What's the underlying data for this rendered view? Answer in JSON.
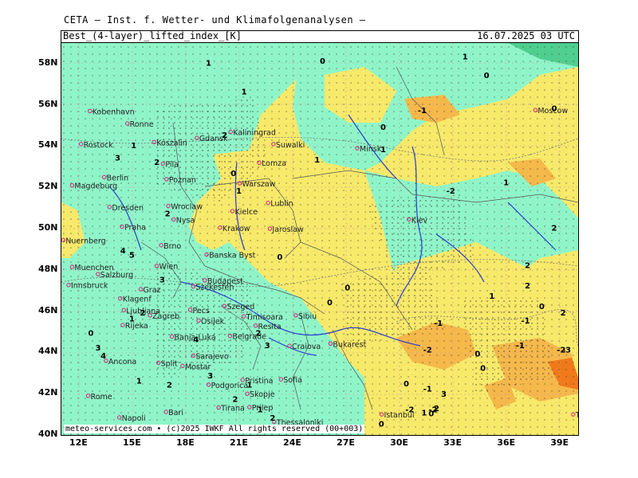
{
  "header": {
    "institution": "CETA — Inst. f. Wetter- und Klimafolgenanalysen —",
    "product": "Best_(4-layer)_lifted_index_[K]",
    "valid_time": "16.07.2025 03 UTC"
  },
  "footer": "meteo-services.com • (c)2025 IWKF All rights reserved (00+003)",
  "colors": {
    "yellow": "#f7e96a",
    "green": "#8ff5c8",
    "teal": "#4ecf8f",
    "orange": "#f5b84a",
    "deep_orange": "#f07a1a",
    "rivers": "#2a3bd0",
    "borders": "#555555",
    "cities": "#d0207a"
  },
  "axes": {
    "lat": [
      "58N",
      "56N",
      "54N",
      "52N",
      "50N",
      "48N",
      "46N",
      "44N",
      "42N",
      "40N"
    ],
    "lon": [
      "12E",
      "15E",
      "18E",
      "21E",
      "24E",
      "27E",
      "30E",
      "33E",
      "36E",
      "39E"
    ]
  },
  "cities": [
    {
      "name": "Kobenhavn",
      "lon": 12.6,
      "lat": 55.7
    },
    {
      "name": "Ronne",
      "lon": 14.7,
      "lat": 55.1
    },
    {
      "name": "Rostock",
      "lon": 12.1,
      "lat": 54.1
    },
    {
      "name": "Koszalin",
      "lon": 16.2,
      "lat": 54.2
    },
    {
      "name": "Gdansk",
      "lon": 18.6,
      "lat": 54.4
    },
    {
      "name": "Kaliningrad",
      "lon": 20.5,
      "lat": 54.7
    },
    {
      "name": "Suwalki",
      "lon": 22.9,
      "lat": 54.1
    },
    {
      "name": "Minsk",
      "lon": 27.6,
      "lat": 53.9
    },
    {
      "name": "Moscow",
      "lon": 37.6,
      "lat": 55.75
    },
    {
      "name": "Pila",
      "lon": 16.7,
      "lat": 53.15
    },
    {
      "name": "Lomza",
      "lon": 22.1,
      "lat": 53.2
    },
    {
      "name": "Berlin",
      "lon": 13.4,
      "lat": 52.5
    },
    {
      "name": "Magdeburg",
      "lon": 11.6,
      "lat": 52.1
    },
    {
      "name": "Poznan",
      "lon": 16.9,
      "lat": 52.4
    },
    {
      "name": "Warszaw",
      "lon": 21.0,
      "lat": 52.2
    },
    {
      "name": "Lublin",
      "lon": 22.6,
      "lat": 51.25
    },
    {
      "name": "Dresden",
      "lon": 13.7,
      "lat": 51.05
    },
    {
      "name": "Wroclaw",
      "lon": 17.0,
      "lat": 51.1
    },
    {
      "name": "Kielce",
      "lon": 20.6,
      "lat": 50.85
    },
    {
      "name": "Nysa",
      "lon": 17.3,
      "lat": 50.45
    },
    {
      "name": "Kiev",
      "lon": 30.5,
      "lat": 50.45
    },
    {
      "name": "Praha",
      "lon": 14.4,
      "lat": 50.1
    },
    {
      "name": "Krakow",
      "lon": 19.9,
      "lat": 50.05
    },
    {
      "name": "Jaroslaw",
      "lon": 22.7,
      "lat": 50.0
    },
    {
      "name": "Nuernberg",
      "lon": 11.1,
      "lat": 49.45
    },
    {
      "name": "Brno",
      "lon": 16.6,
      "lat": 49.2
    },
    {
      "name": "Banska Byst",
      "lon": 19.15,
      "lat": 48.75
    },
    {
      "name": "Muenchen",
      "lon": 11.6,
      "lat": 48.15
    },
    {
      "name": "Wien",
      "lon": 16.35,
      "lat": 48.2
    },
    {
      "name": "Salzburg",
      "lon": 13.05,
      "lat": 47.8
    },
    {
      "name": "Innsbruck",
      "lon": 11.4,
      "lat": 47.27
    },
    {
      "name": "Budapest",
      "lon": 19.05,
      "lat": 47.5
    },
    {
      "name": "Szekesfeh",
      "lon": 18.4,
      "lat": 47.2
    },
    {
      "name": "Graz",
      "lon": 15.45,
      "lat": 47.07
    },
    {
      "name": "Klagenf",
      "lon": 14.3,
      "lat": 46.62
    },
    {
      "name": "Szeged",
      "lon": 20.15,
      "lat": 46.25
    },
    {
      "name": "Ljubljana",
      "lon": 14.5,
      "lat": 46.05
    },
    {
      "name": "Pecs",
      "lon": 18.23,
      "lat": 46.07
    },
    {
      "name": "Zagreb",
      "lon": 15.97,
      "lat": 45.8
    },
    {
      "name": "Rijeka",
      "lon": 14.44,
      "lat": 45.33
    },
    {
      "name": "Osijek",
      "lon": 18.7,
      "lat": 45.55
    },
    {
      "name": "Timisoara",
      "lon": 21.23,
      "lat": 45.75
    },
    {
      "name": "Sibiu",
      "lon": 24.15,
      "lat": 45.8
    },
    {
      "name": "Resita",
      "lon": 21.9,
      "lat": 45.3
    },
    {
      "name": "Banja Luka",
      "lon": 17.2,
      "lat": 44.77
    },
    {
      "name": "Belgrade",
      "lon": 20.46,
      "lat": 44.8
    },
    {
      "name": "Bukarest",
      "lon": 26.1,
      "lat": 44.43
    },
    {
      "name": "Craiova",
      "lon": 23.8,
      "lat": 44.32
    },
    {
      "name": "Ancona",
      "lon": 13.5,
      "lat": 43.6
    },
    {
      "name": "Split",
      "lon": 16.44,
      "lat": 43.5
    },
    {
      "name": "Sarajevo",
      "lon": 18.4,
      "lat": 43.85
    },
    {
      "name": "Mostar",
      "lon": 17.8,
      "lat": 43.35
    },
    {
      "name": "Pristina",
      "lon": 21.17,
      "lat": 42.67
    },
    {
      "name": "Sofia",
      "lon": 23.32,
      "lat": 42.7
    },
    {
      "name": "Podgorica",
      "lon": 19.26,
      "lat": 42.44
    },
    {
      "name": "Skopje",
      "lon": 21.43,
      "lat": 42.0
    },
    {
      "name": "Rome",
      "lon": 12.5,
      "lat": 41.9
    },
    {
      "name": "Tirana",
      "lon": 19.82,
      "lat": 41.33
    },
    {
      "name": "Prilep",
      "lon": 21.55,
      "lat": 41.35
    },
    {
      "name": "Napoli",
      "lon": 14.25,
      "lat": 40.85
    },
    {
      "name": "Bari",
      "lon": 16.87,
      "lat": 41.12
    },
    {
      "name": "Thessaloniki",
      "lon": 22.94,
      "lat": 40.64
    },
    {
      "name": "Istanbul",
      "lon": 28.97,
      "lat": 41.0
    },
    {
      "name": "Trabzon",
      "lon": 39.72,
      "lat": 41.0
    }
  ],
  "values": [
    {
      "v": "1",
      "lon": 19.1,
      "lat": 57.9
    },
    {
      "v": "0",
      "lon": 25.5,
      "lat": 58.0
    },
    {
      "v": "1",
      "lon": 33.5,
      "lat": 58.2
    },
    {
      "v": "0",
      "lon": 34.7,
      "lat": 57.3
    },
    {
      "v": "1",
      "lon": 21.1,
      "lat": 56.5
    },
    {
      "v": "0",
      "lon": 38.5,
      "lat": 55.7
    },
    {
      "v": "-1",
      "lon": 31.0,
      "lat": 55.6
    },
    {
      "v": "0",
      "lon": 28.9,
      "lat": 54.8
    },
    {
      "v": "1",
      "lon": 14.9,
      "lat": 53.9
    },
    {
      "v": "2",
      "lon": 20.0,
      "lat": 54.4
    },
    {
      "v": "1",
      "lon": 28.9,
      "lat": 53.7
    },
    {
      "v": "1",
      "lon": 25.2,
      "lat": 53.2
    },
    {
      "v": "3",
      "lon": 14.0,
      "lat": 53.3
    },
    {
      "v": "2",
      "lon": 16.2,
      "lat": 53.1
    },
    {
      "v": "0",
      "lon": 20.5,
      "lat": 52.55
    },
    {
      "v": "1",
      "lon": 35.8,
      "lat": 52.1
    },
    {
      "v": "1",
      "lon": 20.8,
      "lat": 51.7
    },
    {
      "v": "-2",
      "lon": 32.6,
      "lat": 51.7
    },
    {
      "v": "2",
      "lon": 16.8,
      "lat": 50.6
    },
    {
      "v": "2",
      "lon": 38.5,
      "lat": 49.9
    },
    {
      "v": "4",
      "lon": 14.3,
      "lat": 48.8
    },
    {
      "v": "5",
      "lon": 14.8,
      "lat": 48.6
    },
    {
      "v": "0",
      "lon": 23.1,
      "lat": 48.5
    },
    {
      "v": "2",
      "lon": 37.0,
      "lat": 48.1
    },
    {
      "v": "3",
      "lon": 16.5,
      "lat": 47.4
    },
    {
      "v": "2",
      "lon": 37.0,
      "lat": 47.1
    },
    {
      "v": "0",
      "lon": 26.9,
      "lat": 47.0
    },
    {
      "v": "1",
      "lon": 35.0,
      "lat": 46.6
    },
    {
      "v": "0",
      "lon": 25.9,
      "lat": 46.3
    },
    {
      "v": "0",
      "lon": 37.8,
      "lat": 46.1
    },
    {
      "v": "-1",
      "lon": 36.8,
      "lat": 45.4
    },
    {
      "v": "2",
      "lon": 39.0,
      "lat": 45.8
    },
    {
      "v": "-1",
      "lon": 31.9,
      "lat": 45.3
    },
    {
      "v": "2",
      "lon": 15.4,
      "lat": 45.8
    },
    {
      "v": "1",
      "lon": 14.8,
      "lat": 45.5
    },
    {
      "v": "0",
      "lon": 12.5,
      "lat": 44.8
    },
    {
      "v": "4",
      "lon": 18.4,
      "lat": 44.5
    },
    {
      "v": "2",
      "lon": 21.9,
      "lat": 44.8
    },
    {
      "v": "3",
      "lon": 22.4,
      "lat": 44.2
    },
    {
      "v": "-1",
      "lon": 36.5,
      "lat": 44.2
    },
    {
      "v": "-2",
      "lon": 31.3,
      "lat": 44.0
    },
    {
      "v": "3",
      "lon": 12.9,
      "lat": 44.1
    },
    {
      "v": "-2",
      "lon": 38.8,
      "lat": 44.0
    },
    {
      "v": "-3",
      "lon": 39.1,
      "lat": 44.0
    },
    {
      "v": "4",
      "lon": 13.2,
      "lat": 43.7
    },
    {
      "v": "0",
      "lon": 34.2,
      "lat": 43.8
    },
    {
      "v": "0",
      "lon": 34.5,
      "lat": 43.1
    },
    {
      "v": "3",
      "lon": 19.2,
      "lat": 42.75
    },
    {
      "v": "1",
      "lon": 15.2,
      "lat": 42.5
    },
    {
      "v": "2",
      "lon": 16.9,
      "lat": 42.3
    },
    {
      "v": "1",
      "lon": 21.4,
      "lat": 42.3
    },
    {
      "v": "0",
      "lon": 30.2,
      "lat": 42.35
    },
    {
      "v": "-1",
      "lon": 31.3,
      "lat": 42.1
    },
    {
      "v": "3",
      "lon": 32.3,
      "lat": 41.85
    },
    {
      "v": "2",
      "lon": 20.6,
      "lat": 41.6
    },
    {
      "v": "1",
      "lon": 22.0,
      "lat": 41.1
    },
    {
      "v": "-2",
      "lon": 31.6,
      "lat": 41.1
    },
    {
      "v": "2",
      "lon": 31.9,
      "lat": 41.15
    },
    {
      "v": "1",
      "lon": 31.2,
      "lat": 40.95
    },
    {
      "v": "0",
      "lon": 31.6,
      "lat": 40.9
    },
    {
      "v": "2",
      "lon": 22.7,
      "lat": 40.7
    },
    {
      "v": "0",
      "lon": 28.8,
      "lat": 40.4
    },
    {
      "v": "-2",
      "lon": 30.3,
      "lat": 41.1
    }
  ]
}
